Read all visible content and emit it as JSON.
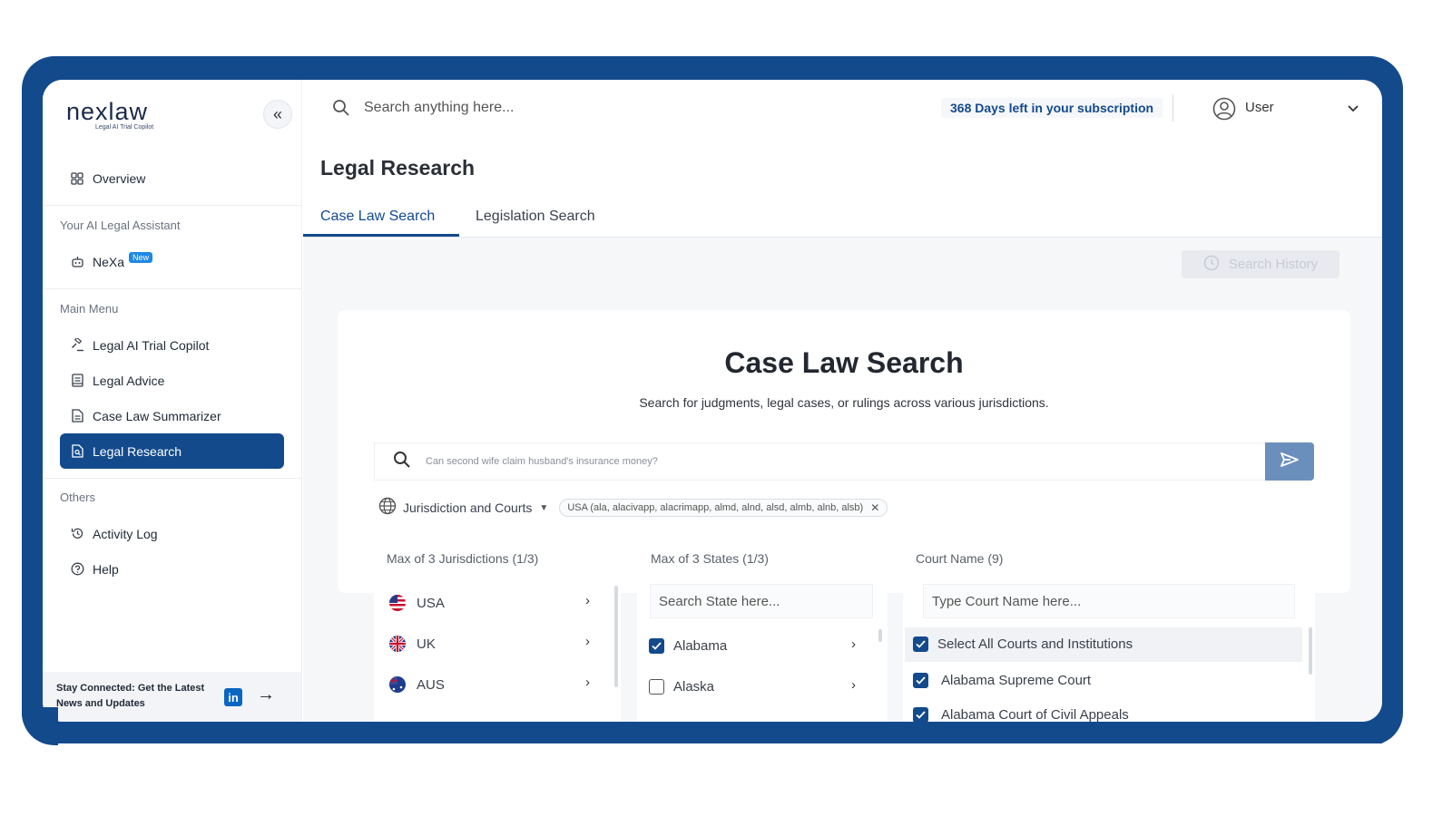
{
  "brand": {
    "name": "nexlaw",
    "tagline": "Legal AI Trial Copilot"
  },
  "sidebar": {
    "overview": "Overview",
    "assistant_section": "Your AI Legal Assistant",
    "nexa": "NeXa",
    "nexa_badge": "New",
    "main_menu_section": "Main Menu",
    "items": [
      {
        "label": "Legal AI Trial Copilot",
        "icon": "gavel-icon"
      },
      {
        "label": "Legal Advice",
        "icon": "book-icon"
      },
      {
        "label": "Case Law Summarizer",
        "icon": "document-icon"
      },
      {
        "label": "Legal Research",
        "icon": "search-document-icon",
        "active": true
      }
    ],
    "others_section": "Others",
    "others": [
      {
        "label": "Activity Log",
        "icon": "history-icon"
      },
      {
        "label": "Help",
        "icon": "help-icon"
      }
    ],
    "promo_text": "Stay Connected: Get the Latest News and Updates",
    "promo_social": "in"
  },
  "topbar": {
    "search_placeholder": "Search anything here...",
    "subscription": "368 Days left in your subscription",
    "user": "User"
  },
  "page": {
    "title": "Legal Research",
    "tabs": [
      {
        "label": "Case Law Search",
        "active": true
      },
      {
        "label": "Legislation Search",
        "active": false
      }
    ],
    "history_button": "Search History"
  },
  "search_card": {
    "title": "Case Law Search",
    "subtitle": "Search for judgments, legal cases, or rulings across various jurisdictions.",
    "query_placeholder": "Can second wife claim husband's insurance money?"
  },
  "filter": {
    "label": "Jurisdiction and Courts",
    "chip": "USA (ala, alacivapp, alacrimapp, almd, alnd, alsd, almb, alnb, alsb)"
  },
  "jurisdictions": {
    "header": "Max of 3 Jurisdictions (1/3)",
    "items": [
      "USA",
      "UK",
      "AUS"
    ]
  },
  "states": {
    "header": "Max of 3 States (1/3)",
    "search_placeholder": "Search State here...",
    "items": [
      {
        "label": "Alabama",
        "checked": true
      },
      {
        "label": "Alaska",
        "checked": false
      }
    ]
  },
  "courts": {
    "header": "Court Name (9)",
    "search_placeholder": "Type Court Name here...",
    "items": [
      {
        "label": "Select All Courts and Institutions",
        "checked": true
      },
      {
        "label": "Alabama Supreme Court",
        "checked": true
      },
      {
        "label": "Alabama Court of Civil Appeals",
        "checked": true
      }
    ]
  },
  "colors": {
    "primary": "#134a8c",
    "send": "#6b8fbd",
    "frame": "#134a8c"
  }
}
